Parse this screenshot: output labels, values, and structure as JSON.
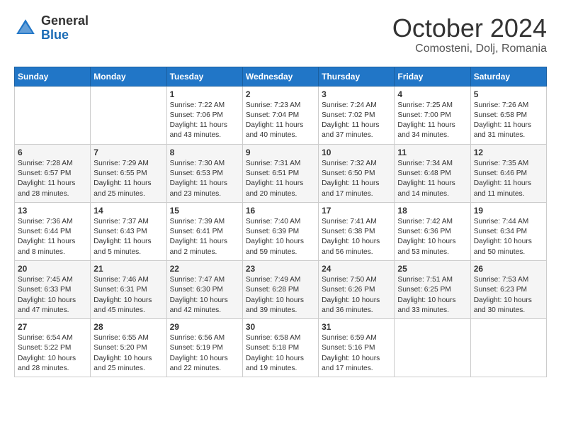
{
  "header": {
    "logo_general": "General",
    "logo_blue": "Blue",
    "title": "October 2024",
    "location": "Comosteni, Dolj, Romania"
  },
  "days_of_week": [
    "Sunday",
    "Monday",
    "Tuesday",
    "Wednesday",
    "Thursday",
    "Friday",
    "Saturday"
  ],
  "weeks": [
    [
      {
        "day": "",
        "content": ""
      },
      {
        "day": "",
        "content": ""
      },
      {
        "day": "1",
        "content": "Sunrise: 7:22 AM\nSunset: 7:06 PM\nDaylight: 11 hours and 43 minutes."
      },
      {
        "day": "2",
        "content": "Sunrise: 7:23 AM\nSunset: 7:04 PM\nDaylight: 11 hours and 40 minutes."
      },
      {
        "day": "3",
        "content": "Sunrise: 7:24 AM\nSunset: 7:02 PM\nDaylight: 11 hours and 37 minutes."
      },
      {
        "day": "4",
        "content": "Sunrise: 7:25 AM\nSunset: 7:00 PM\nDaylight: 11 hours and 34 minutes."
      },
      {
        "day": "5",
        "content": "Sunrise: 7:26 AM\nSunset: 6:58 PM\nDaylight: 11 hours and 31 minutes."
      }
    ],
    [
      {
        "day": "6",
        "content": "Sunrise: 7:28 AM\nSunset: 6:57 PM\nDaylight: 11 hours and 28 minutes."
      },
      {
        "day": "7",
        "content": "Sunrise: 7:29 AM\nSunset: 6:55 PM\nDaylight: 11 hours and 25 minutes."
      },
      {
        "day": "8",
        "content": "Sunrise: 7:30 AM\nSunset: 6:53 PM\nDaylight: 11 hours and 23 minutes."
      },
      {
        "day": "9",
        "content": "Sunrise: 7:31 AM\nSunset: 6:51 PM\nDaylight: 11 hours and 20 minutes."
      },
      {
        "day": "10",
        "content": "Sunrise: 7:32 AM\nSunset: 6:50 PM\nDaylight: 11 hours and 17 minutes."
      },
      {
        "day": "11",
        "content": "Sunrise: 7:34 AM\nSunset: 6:48 PM\nDaylight: 11 hours and 14 minutes."
      },
      {
        "day": "12",
        "content": "Sunrise: 7:35 AM\nSunset: 6:46 PM\nDaylight: 11 hours and 11 minutes."
      }
    ],
    [
      {
        "day": "13",
        "content": "Sunrise: 7:36 AM\nSunset: 6:44 PM\nDaylight: 11 hours and 8 minutes."
      },
      {
        "day": "14",
        "content": "Sunrise: 7:37 AM\nSunset: 6:43 PM\nDaylight: 11 hours and 5 minutes."
      },
      {
        "day": "15",
        "content": "Sunrise: 7:39 AM\nSunset: 6:41 PM\nDaylight: 11 hours and 2 minutes."
      },
      {
        "day": "16",
        "content": "Sunrise: 7:40 AM\nSunset: 6:39 PM\nDaylight: 10 hours and 59 minutes."
      },
      {
        "day": "17",
        "content": "Sunrise: 7:41 AM\nSunset: 6:38 PM\nDaylight: 10 hours and 56 minutes."
      },
      {
        "day": "18",
        "content": "Sunrise: 7:42 AM\nSunset: 6:36 PM\nDaylight: 10 hours and 53 minutes."
      },
      {
        "day": "19",
        "content": "Sunrise: 7:44 AM\nSunset: 6:34 PM\nDaylight: 10 hours and 50 minutes."
      }
    ],
    [
      {
        "day": "20",
        "content": "Sunrise: 7:45 AM\nSunset: 6:33 PM\nDaylight: 10 hours and 47 minutes."
      },
      {
        "day": "21",
        "content": "Sunrise: 7:46 AM\nSunset: 6:31 PM\nDaylight: 10 hours and 45 minutes."
      },
      {
        "day": "22",
        "content": "Sunrise: 7:47 AM\nSunset: 6:30 PM\nDaylight: 10 hours and 42 minutes."
      },
      {
        "day": "23",
        "content": "Sunrise: 7:49 AM\nSunset: 6:28 PM\nDaylight: 10 hours and 39 minutes."
      },
      {
        "day": "24",
        "content": "Sunrise: 7:50 AM\nSunset: 6:26 PM\nDaylight: 10 hours and 36 minutes."
      },
      {
        "day": "25",
        "content": "Sunrise: 7:51 AM\nSunset: 6:25 PM\nDaylight: 10 hours and 33 minutes."
      },
      {
        "day": "26",
        "content": "Sunrise: 7:53 AM\nSunset: 6:23 PM\nDaylight: 10 hours and 30 minutes."
      }
    ],
    [
      {
        "day": "27",
        "content": "Sunrise: 6:54 AM\nSunset: 5:22 PM\nDaylight: 10 hours and 28 minutes."
      },
      {
        "day": "28",
        "content": "Sunrise: 6:55 AM\nSunset: 5:20 PM\nDaylight: 10 hours and 25 minutes."
      },
      {
        "day": "29",
        "content": "Sunrise: 6:56 AM\nSunset: 5:19 PM\nDaylight: 10 hours and 22 minutes."
      },
      {
        "day": "30",
        "content": "Sunrise: 6:58 AM\nSunset: 5:18 PM\nDaylight: 10 hours and 19 minutes."
      },
      {
        "day": "31",
        "content": "Sunrise: 6:59 AM\nSunset: 5:16 PM\nDaylight: 10 hours and 17 minutes."
      },
      {
        "day": "",
        "content": ""
      },
      {
        "day": "",
        "content": ""
      }
    ]
  ]
}
